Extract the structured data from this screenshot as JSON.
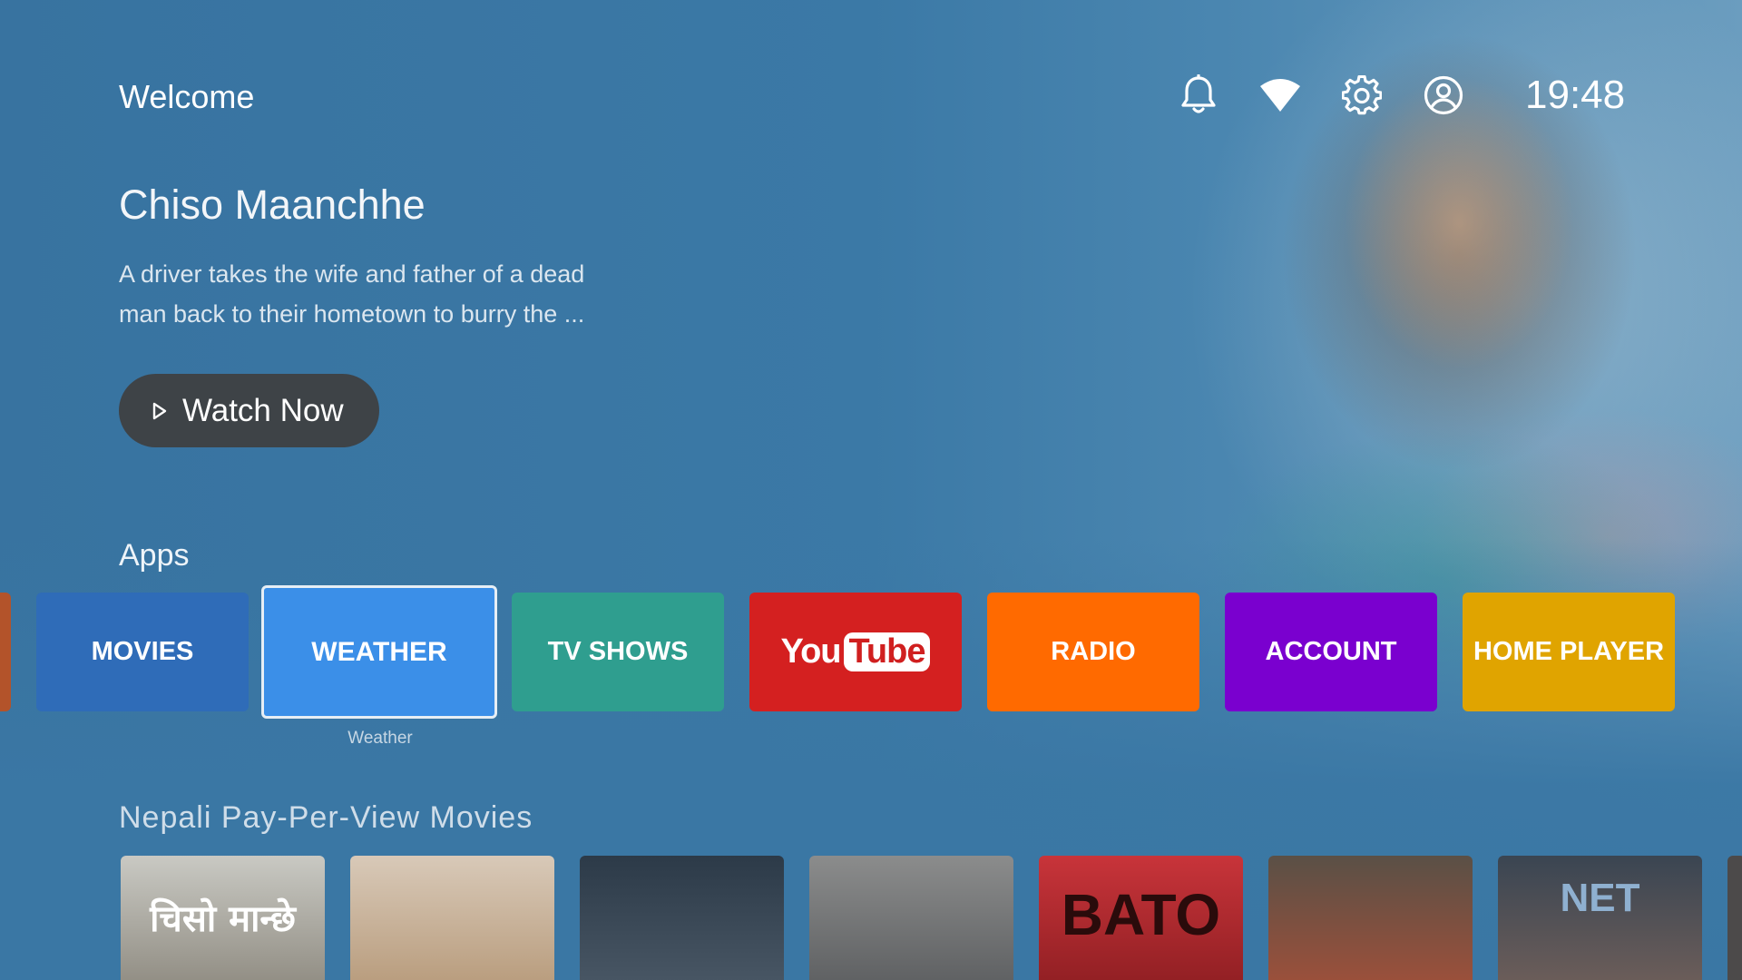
{
  "header": {
    "welcome": "Welcome",
    "clock": "19:48",
    "icons": [
      "bell-icon",
      "wifi-icon",
      "gear-icon",
      "account-circle-icon"
    ]
  },
  "hero": {
    "title": "Chiso Maanchhe",
    "description_line1": "A driver takes the wife and father of a dead",
    "description_line2": "man back to their hometown to burry the ...",
    "watch_button": "Watch Now"
  },
  "apps": {
    "title": "Apps",
    "focused_caption": "Weather",
    "tiles": [
      {
        "label": "MOVIES",
        "color": "#2f6cb8"
      },
      {
        "label": "WEATHER",
        "color": "#3b8fe8",
        "focused": true
      },
      {
        "label": "TV SHOWS",
        "color": "#2f9e8f"
      },
      {
        "label": "YouTube",
        "you": "You",
        "tube": "Tube",
        "color": "#d42020"
      },
      {
        "label": "RADIO",
        "color": "#ff6a00"
      },
      {
        "label": "ACCOUNT",
        "color": "#7a00cf"
      },
      {
        "label": "HOME PLAYER",
        "color": "#e0a400"
      }
    ]
  },
  "movies": {
    "title": "Nepali Pay-Per-View Movies",
    "posters": [
      {
        "name": "poster-chiso-maanchhe",
        "text": "चिसो मान्छे",
        "colors": [
          "#c9c9c3",
          "#8e8a80"
        ]
      },
      {
        "name": "poster-2",
        "text": "",
        "colors": [
          "#d8c9b8",
          "#b79a7a"
        ]
      },
      {
        "name": "poster-3",
        "text": "",
        "colors": [
          "#2c3a48",
          "#4a5866"
        ]
      },
      {
        "name": "poster-4",
        "text": "",
        "colors": [
          "#8b8c8c",
          "#5c5e60"
        ]
      },
      {
        "name": "poster-bato",
        "text": "BATO",
        "colors": [
          "#c8343a",
          "#8e1e22"
        ]
      },
      {
        "name": "poster-6",
        "text": "",
        "colors": [
          "#5a5046",
          "#a0503a"
        ]
      },
      {
        "name": "poster-net",
        "text": "NET",
        "colors": [
          "#3a4552",
          "#6f5f5a"
        ]
      }
    ]
  }
}
